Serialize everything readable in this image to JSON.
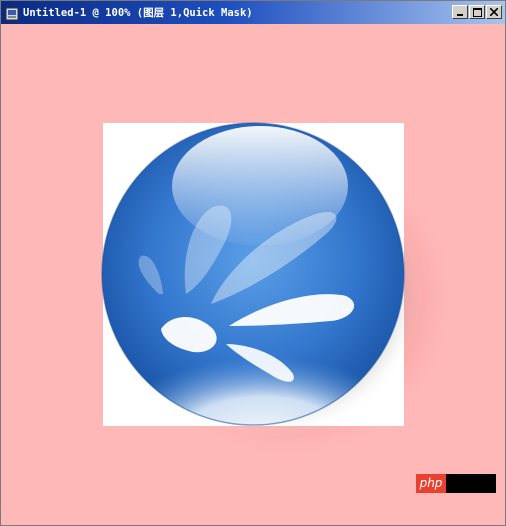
{
  "window": {
    "title": "Untitled-1 @ 100% (图层 1,Quick Mask)",
    "icon": "photoshop-document-icon",
    "controls": [
      "minimize-icon",
      "maximize-icon",
      "close-icon"
    ]
  },
  "canvas": {
    "background_color": "#ffb8b8",
    "artboard_color": "#ffffff",
    "orb_color": "#2a6fc8",
    "highlight_color": "#ffffff"
  },
  "watermark": {
    "text": "php"
  }
}
